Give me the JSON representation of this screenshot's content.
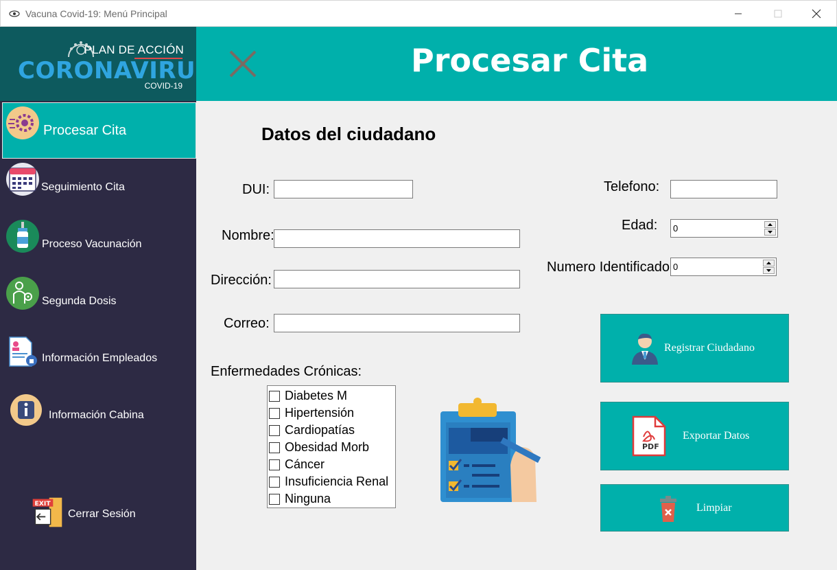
{
  "window": {
    "title": "Vacuna Covid-19: Menú Principal"
  },
  "logo": {
    "plan": "PLAN DE ACCIÓN",
    "main": "CORONAVIRUS",
    "sub": "COVID-19"
  },
  "sidebar": {
    "items": [
      {
        "label": "Procesar Cita",
        "icon": "gear-icon",
        "active": true
      },
      {
        "label": "Seguimiento Cita",
        "icon": "calendar-icon"
      },
      {
        "label": "Proceso Vacunación",
        "icon": "vaccine-icon"
      },
      {
        "label": "Segunda Dosis",
        "icon": "patient-icon"
      },
      {
        "label": "Información Empleados",
        "icon": "employee-document-icon"
      },
      {
        "label": "Información Cabina",
        "icon": "info-icon"
      }
    ],
    "logout": {
      "label": "Cerrar Sesión",
      "icon": "exit-door-icon"
    }
  },
  "header": {
    "title": "Procesar Cita"
  },
  "form": {
    "section_title": "Datos del ciudadano",
    "dui_label": "DUI:",
    "dui_value": "",
    "nombre_label": "Nombre:",
    "nombre_value": "",
    "direccion_label": "Dirección:",
    "direccion_value": "",
    "correo_label": "Correo:",
    "correo_value": "",
    "telefono_label": "Telefono:",
    "telefono_value": "",
    "edad_label": "Edad:",
    "edad_value": "0",
    "numero_label": "Numero Identificador",
    "numero_value": "0",
    "enfermedades_label": "Enfermedades Crónicas:",
    "enfermedades": [
      "Diabetes M",
      "Hipertensión",
      "Cardiopatías",
      "Obesidad Morb",
      "Cáncer",
      "Insuficiencia Renal",
      "Ninguna"
    ]
  },
  "actions": {
    "registrar": "Registrar Ciudadano",
    "exportar": "Exportar Datos",
    "pdf_text": "PDF",
    "limpiar": "Limpiar"
  },
  "colors": {
    "teal": "#00b0ab",
    "sidebar": "#2d2a44",
    "logo_bg": "#0d5a5e",
    "panel": "#f0f0f0"
  }
}
